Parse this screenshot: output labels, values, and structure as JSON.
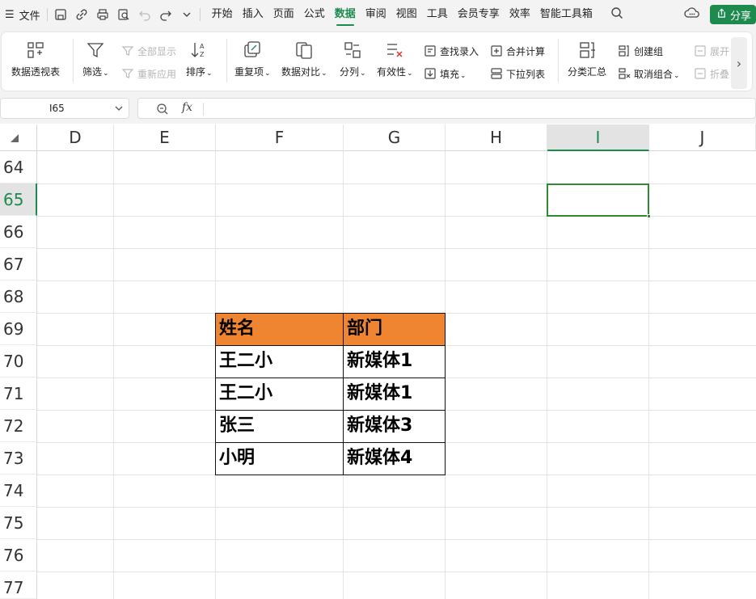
{
  "menubar": {
    "file_label": "文件",
    "tabs": [
      "开始",
      "插入",
      "页面",
      "公式",
      "数据",
      "审阅",
      "视图",
      "工具",
      "会员专享",
      "效率",
      "智能工具箱"
    ],
    "active_tab": "数据",
    "share_label": "分享"
  },
  "ribbon": {
    "pivot": "数据透视表",
    "filter": "筛选",
    "show_all": "全部显示",
    "reapply": "重新应用",
    "sort": "排序",
    "duplicates": "重复项",
    "compare": "数据对比",
    "split": "分列",
    "validity": "有效性",
    "lookup_entry": "查找录入",
    "fill": "填充",
    "consolidate": "合并计算",
    "dropdown_list": "下拉列表",
    "subtotal": "分类汇总",
    "create_group": "创建组",
    "ungroup": "取消组合",
    "expand": "展开",
    "collapse": "折叠"
  },
  "formula_bar": {
    "cell_ref": "I65",
    "fx": "fx",
    "formula": ""
  },
  "grid": {
    "columns": [
      "D",
      "E",
      "F",
      "G",
      "H",
      "I",
      "J"
    ],
    "selected_column": "I",
    "rows": [
      "64",
      "65",
      "66",
      "67",
      "68",
      "69",
      "70",
      "71",
      "72",
      "73",
      "74",
      "75",
      "76",
      "77"
    ],
    "selected_row": "65",
    "active_cell": "I65"
  },
  "table": {
    "header_color": "#ef8530",
    "headers": [
      "姓名",
      "部门"
    ],
    "rows": [
      [
        "王二小",
        "新媒体1"
      ],
      [
        "王二小",
        "新媒体1"
      ],
      [
        "张三",
        "新媒体3"
      ],
      [
        "小明",
        "新媒体4"
      ]
    ]
  },
  "colors": {
    "accent": "#1d8a4e",
    "active_cell_border": "#2e8b2e"
  }
}
